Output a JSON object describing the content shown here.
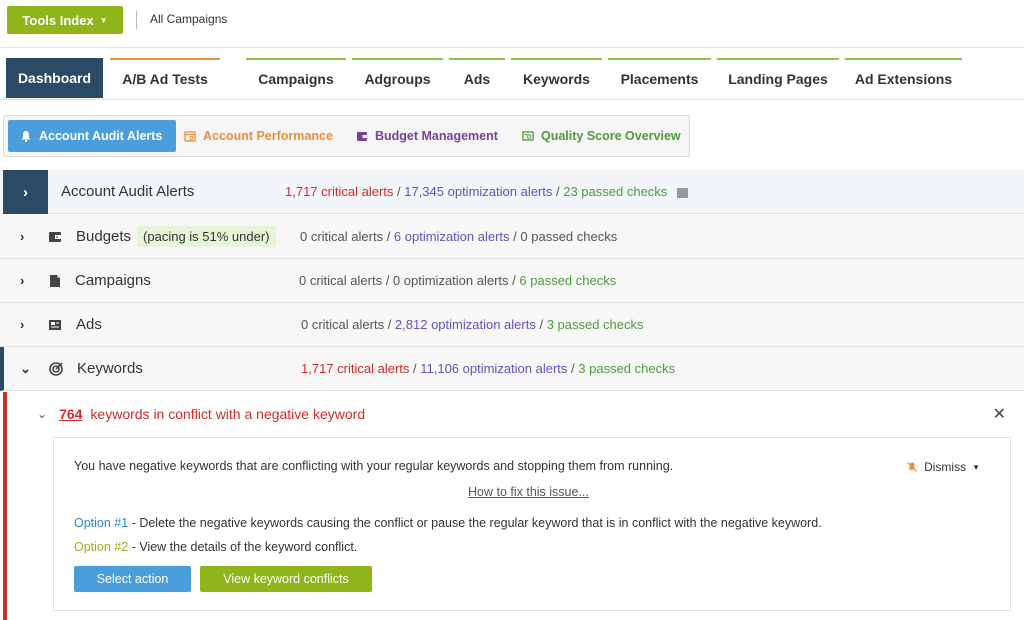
{
  "topbar": {
    "tools_label": "Tools Index",
    "breadcrumb": "All Campaigns"
  },
  "nav": {
    "tabs": [
      {
        "label": "Dashboard",
        "active": true
      },
      {
        "label": "A/B Ad Tests"
      },
      {
        "label": "Campaigns"
      },
      {
        "label": "Adgroups"
      },
      {
        "label": "Ads"
      },
      {
        "label": "Keywords"
      },
      {
        "label": "Placements"
      },
      {
        "label": "Landing Pages"
      },
      {
        "label": "Ad Extensions"
      }
    ]
  },
  "subtabs": [
    {
      "label": "Account Audit Alerts",
      "icon": "bell-icon",
      "color": "#ffffff"
    },
    {
      "label": "Account Performance",
      "icon": "calendar-chart-icon",
      "color": "#e8913a"
    },
    {
      "label": "Budget Management",
      "icon": "wallet-icon",
      "color": "#7b3fa0"
    },
    {
      "label": "Quality Score Overview",
      "icon": "scorecard-icon",
      "color": "#4f9a3d"
    }
  ],
  "audit": {
    "title": "Account Audit Alerts",
    "critical": "1,717 critical alerts",
    "optimization": "17,345 optimization alerts",
    "passed": "23 passed checks",
    "sep": " / "
  },
  "rows": [
    {
      "title": "Budgets",
      "pill": "(pacing is 51% under)",
      "critical": "0 critical alerts",
      "optimization": "6 optimization alerts",
      "passed": "0 passed checks"
    },
    {
      "title": "Campaigns",
      "critical": "0 critical alerts",
      "optimization": "0 optimization alerts",
      "passed": "6 passed checks"
    },
    {
      "title": "Ads",
      "critical": "0 critical alerts",
      "optimization": "2,812 optimization alerts",
      "passed": "3 passed checks"
    },
    {
      "title": "Keywords",
      "critical": "1,717 critical alerts",
      "optimization": "11,106 optimization alerts",
      "passed": "3 passed checks"
    }
  ],
  "alert": {
    "count": "764",
    "text": "keywords in conflict with a negative keyword",
    "description": "You have negative keywords that are conflicting with your regular keywords and stopping them from running.",
    "dismiss_label": "Dismiss",
    "howto_label": "How to fix this issue...",
    "option1_label": "Option #1",
    "option1_text": " - Delete the negative keywords causing the conflict or pause the regular keyword that is in conflict with the negative keyword.",
    "option2_label": "Option #2",
    "option2_text": " - View the details of the keyword conflict.",
    "select_action_label": "Select action",
    "view_conflicts_label": "View keyword conflicts"
  },
  "colors": {
    "brand_green": "#8fb51a",
    "nav_dark": "#2b4a66",
    "accent_blue": "#4a9edb",
    "critical_red": "#d12b2b",
    "optimization_purple": "#6a4fbd",
    "passed_green": "#4f9a3d"
  }
}
